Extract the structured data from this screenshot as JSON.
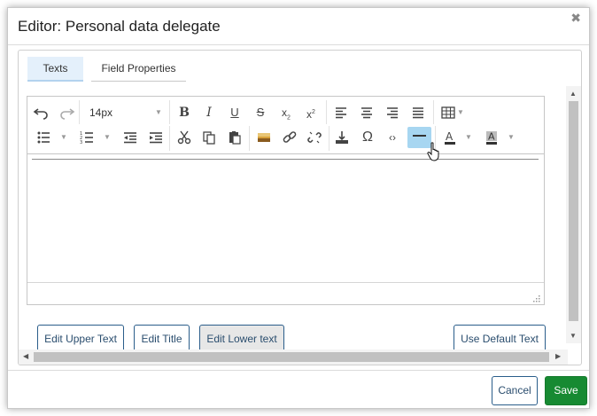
{
  "dialog": {
    "title": "Editor: Personal data delegate",
    "close_icon": "close-icon"
  },
  "tabs": [
    {
      "label": "Texts",
      "active": true
    },
    {
      "label": "Field Properties",
      "active": false
    }
  ],
  "toolbar": {
    "font_size": "14px",
    "row1_icons": [
      "undo-icon",
      "redo-icon",
      "bold-icon",
      "italic-icon",
      "underline-icon",
      "strikethrough-icon",
      "subscript-icon",
      "superscript-icon",
      "align-left-icon",
      "align-center-icon",
      "align-right-icon",
      "align-justify-icon",
      "table-icon"
    ],
    "row2_icons": [
      "bullet-list-icon",
      "numbered-list-icon",
      "outdent-icon",
      "indent-icon",
      "cut-icon",
      "copy-icon",
      "paste-icon",
      "image-icon",
      "link-icon",
      "unlink-icon",
      "anchor-icon",
      "special-character-icon",
      "source-code-icon",
      "horizontal-rule-icon",
      "text-color-icon",
      "background-color-icon"
    ],
    "active_button": "horizontal-rule-icon"
  },
  "buttons": {
    "edit_upper": "Edit Upper Text",
    "edit_title": "Edit Title",
    "edit_lower": "Edit Lower text",
    "use_default": "Use Default Text"
  },
  "footer": {
    "cancel": "Cancel",
    "save": "Save"
  },
  "colors": {
    "save_green": "#178a32",
    "active_tool_blue": "#a7d6f1",
    "button_border_blue": "#2a5d8a"
  }
}
